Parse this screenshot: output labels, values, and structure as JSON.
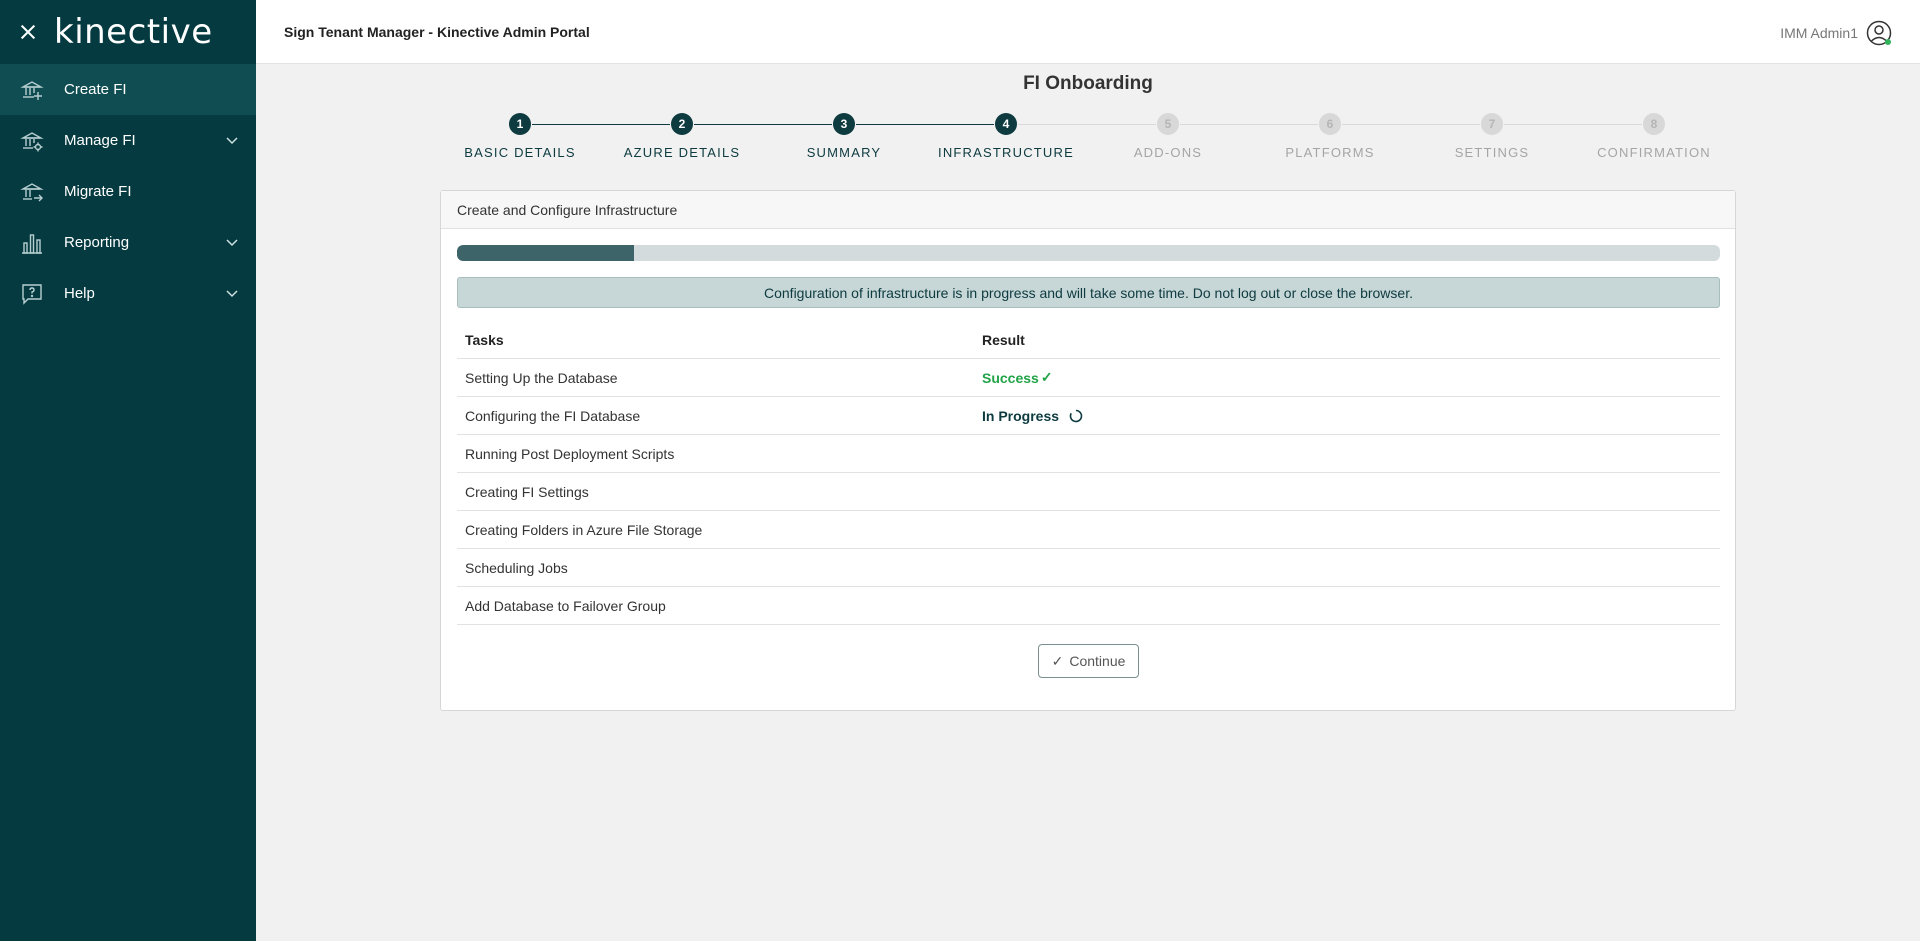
{
  "sidebar": {
    "logo": "kinective",
    "items": [
      {
        "label": "Create FI",
        "icon": "bank-add-icon",
        "active": true,
        "expandable": false
      },
      {
        "label": "Manage FI",
        "icon": "bank-settings-icon",
        "active": false,
        "expandable": true
      },
      {
        "label": "Migrate FI",
        "icon": "bank-migrate-icon",
        "active": false,
        "expandable": false
      },
      {
        "label": "Reporting",
        "icon": "bar-chart-icon",
        "active": false,
        "expandable": true
      },
      {
        "label": "Help",
        "icon": "help-chat-icon",
        "active": false,
        "expandable": true
      }
    ]
  },
  "header": {
    "title": "Sign Tenant Manager - Kinective Admin Portal",
    "user_name": "IMM Admin1"
  },
  "page": {
    "title": "FI Onboarding"
  },
  "stepper": {
    "current": 4,
    "steps": [
      {
        "number": "1",
        "label": "BASIC DETAILS"
      },
      {
        "number": "2",
        "label": "AZURE DETAILS"
      },
      {
        "number": "3",
        "label": "SUMMARY"
      },
      {
        "number": "4",
        "label": "INFRASTRUCTURE"
      },
      {
        "number": "5",
        "label": "ADD-ONS"
      },
      {
        "number": "6",
        "label": "PLATFORMS"
      },
      {
        "number": "7",
        "label": "SETTINGS"
      },
      {
        "number": "8",
        "label": "CONFIRMATION"
      }
    ]
  },
  "card": {
    "title": "Create and Configure Infrastructure",
    "progress_percent": 14,
    "alert": "Configuration of infrastructure is in progress and will take some time. Do not log out or close the browser.",
    "columns": {
      "tasks": "Tasks",
      "result": "Result"
    },
    "tasks": [
      {
        "name": "Setting Up the Database",
        "result": "Success",
        "status": "success"
      },
      {
        "name": "Configuring the FI Database",
        "result": "In Progress",
        "status": "in-progress"
      },
      {
        "name": "Running Post Deployment Scripts",
        "result": "",
        "status": "pending"
      },
      {
        "name": "Creating FI Settings",
        "result": "",
        "status": "pending"
      },
      {
        "name": "Creating Folders in Azure File Storage",
        "result": "",
        "status": "pending"
      },
      {
        "name": "Scheduling Jobs",
        "result": "",
        "status": "pending"
      },
      {
        "name": "Add Database to Failover Group",
        "result": "",
        "status": "pending"
      }
    ],
    "continue_label": "Continue"
  },
  "colors": {
    "sidebar_bg": "#053b40",
    "accent": "#0d3b40",
    "success": "#21a348",
    "progress_fill": "#3d6469"
  }
}
